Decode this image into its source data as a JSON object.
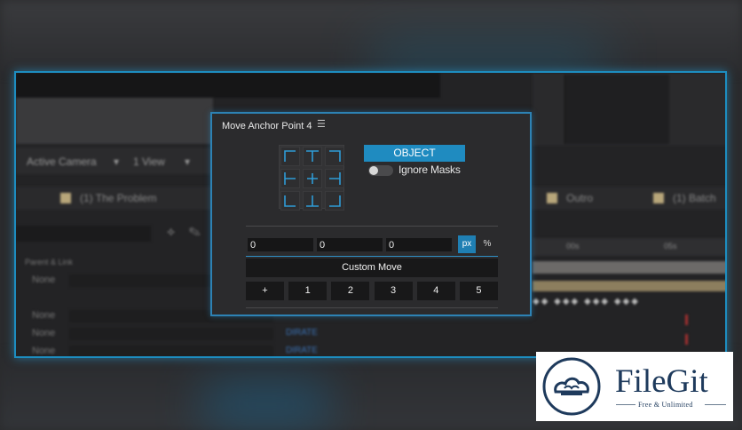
{
  "background_ui": {
    "camera_dropdown": "Active Camera",
    "view_dropdown": "1 View",
    "comp_tab_1": "(1) The Problem",
    "comp_tab_2": "Outro",
    "comp_tab_3": "(1) Batch",
    "ruler_labels": [
      "00s",
      "05s"
    ],
    "layer_header": "Parent & Link",
    "layer_rows": [
      {
        "name": "None",
        "mode": ""
      },
      {
        "name": "",
        "mode": ""
      },
      {
        "name": "None",
        "mode": ""
      },
      {
        "name": "None",
        "mode": "DIRATE"
      },
      {
        "name": "None",
        "mode": "DIRATE"
      }
    ]
  },
  "panel": {
    "title": "Move Anchor Point 4",
    "menu_icon": "hamburger-menu-icon",
    "anchor_grid": [
      "top-left",
      "top-center",
      "top-right",
      "middle-left",
      "center",
      "middle-right",
      "bottom-left",
      "bottom-center",
      "bottom-right"
    ],
    "object_button": "OBJECT",
    "ignore_masks_label": "Ignore Masks",
    "ignore_masks_on": false,
    "x_value": "0",
    "y_value": "0",
    "z_value": "0",
    "unit_px": "px",
    "unit_percent": "%",
    "selected_unit": "px",
    "custom_move_label": "Custom Move",
    "step_buttons": [
      "+",
      "1",
      "2",
      "3",
      "4",
      "5"
    ],
    "accent_color": "#1f8bc0"
  },
  "watermark": {
    "name": "FileGit",
    "tagline": "Free & Unlimited"
  }
}
